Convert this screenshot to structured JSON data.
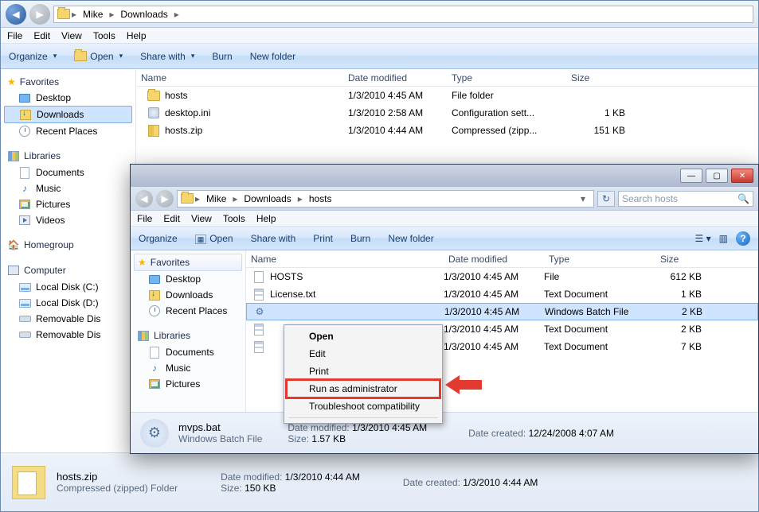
{
  "back": {
    "breadcrumb": [
      "Mike",
      "Downloads"
    ],
    "menu": [
      "File",
      "Edit",
      "View",
      "Tools",
      "Help"
    ],
    "cmd": {
      "organize": "Organize",
      "open": "Open",
      "share": "Share with",
      "burn": "Burn",
      "newfolder": "New folder"
    },
    "cols": {
      "name": "Name",
      "date": "Date modified",
      "type": "Type",
      "size": "Size"
    },
    "rows": [
      {
        "icon": "folder",
        "name": "hosts",
        "date": "1/3/2010 4:45 AM",
        "type": "File folder",
        "size": ""
      },
      {
        "icon": "ini",
        "name": "desktop.ini",
        "date": "1/3/2010 2:58 AM",
        "type": "Configuration sett...",
        "size": "1 KB"
      },
      {
        "icon": "zip",
        "name": "hosts.zip",
        "date": "1/3/2010 4:44 AM",
        "type": "Compressed (zipp...",
        "size": "151 KB"
      }
    ],
    "nav": {
      "favorites": "Favorites",
      "fav_items": [
        {
          "icon": "desk",
          "label": "Desktop"
        },
        {
          "icon": "dl",
          "label": "Downloads",
          "sel": true
        },
        {
          "icon": "clock",
          "label": "Recent Places"
        }
      ],
      "libraries": "Libraries",
      "lib_items": [
        {
          "icon": "doc",
          "label": "Documents"
        },
        {
          "icon": "music",
          "label": "Music"
        },
        {
          "icon": "pic",
          "label": "Pictures"
        },
        {
          "icon": "vid",
          "label": "Videos"
        }
      ],
      "homegroup": "Homegroup",
      "computer": "Computer",
      "comp_items": [
        {
          "icon": "disk",
          "label": "Local Disk (C:)"
        },
        {
          "icon": "disk",
          "label": "Local Disk (D:)"
        },
        {
          "icon": "rem",
          "label": "Removable Dis"
        },
        {
          "icon": "rem",
          "label": "Removable Dis"
        }
      ]
    },
    "status": {
      "name": "hosts.zip",
      "sub": "Compressed (zipped) Folder",
      "dm_label": "Date modified:",
      "dm": "1/3/2010 4:44 AM",
      "sz_label": "Size:",
      "sz": "150 KB",
      "dc_label": "Date created:",
      "dc": "1/3/2010 4:44 AM"
    }
  },
  "front": {
    "breadcrumb": [
      "Mike",
      "Downloads",
      "hosts"
    ],
    "search_placeholder": "Search hosts",
    "menu": [
      "File",
      "Edit",
      "View",
      "Tools",
      "Help"
    ],
    "cmd": {
      "organize": "Organize",
      "open": "Open",
      "share": "Share with",
      "print": "Print",
      "burn": "Burn",
      "newfolder": "New folder"
    },
    "cols": {
      "name": "Name",
      "date": "Date modified",
      "type": "Type",
      "size": "Size"
    },
    "rows": [
      {
        "icon": "file",
        "name": "HOSTS",
        "date": "1/3/2010 4:45 AM",
        "type": "File",
        "size": "612 KB"
      },
      {
        "icon": "txt",
        "name": "License.txt",
        "date": "1/3/2010 4:45 AM",
        "type": "Text Document",
        "size": "1 KB"
      },
      {
        "icon": "gear",
        "name": "",
        "date": "1/3/2010 4:45 AM",
        "type": "Windows Batch File",
        "size": "2 KB",
        "sel": true
      },
      {
        "icon": "txt",
        "name": "",
        "date": "1/3/2010 4:45 AM",
        "type": "Text Document",
        "size": "2 KB"
      },
      {
        "icon": "txt",
        "name": "",
        "date": "1/3/2010 4:45 AM",
        "type": "Text Document",
        "size": "7 KB"
      }
    ],
    "nav": {
      "favorites": "Favorites",
      "fav_items": [
        {
          "icon": "desk",
          "label": "Desktop"
        },
        {
          "icon": "dl",
          "label": "Downloads"
        },
        {
          "icon": "clock",
          "label": "Recent Places"
        }
      ],
      "libraries": "Libraries",
      "lib_items": [
        {
          "icon": "doc",
          "label": "Documents"
        },
        {
          "icon": "music",
          "label": "Music"
        },
        {
          "icon": "pic",
          "label": "Pictures"
        }
      ]
    },
    "status": {
      "name": "mvps.bat",
      "sub": "Windows Batch File",
      "dm_label": "Date modified:",
      "dm": "1/3/2010 4:45 AM",
      "sz_label": "Size:",
      "sz": "1.57 KB",
      "dc_label": "Date created:",
      "dc": "12/24/2008 4:07 AM"
    }
  },
  "ctx": {
    "open": "Open",
    "edit": "Edit",
    "print": "Print",
    "runas": "Run as administrator",
    "troubleshoot": "Troubleshoot compatibility"
  }
}
